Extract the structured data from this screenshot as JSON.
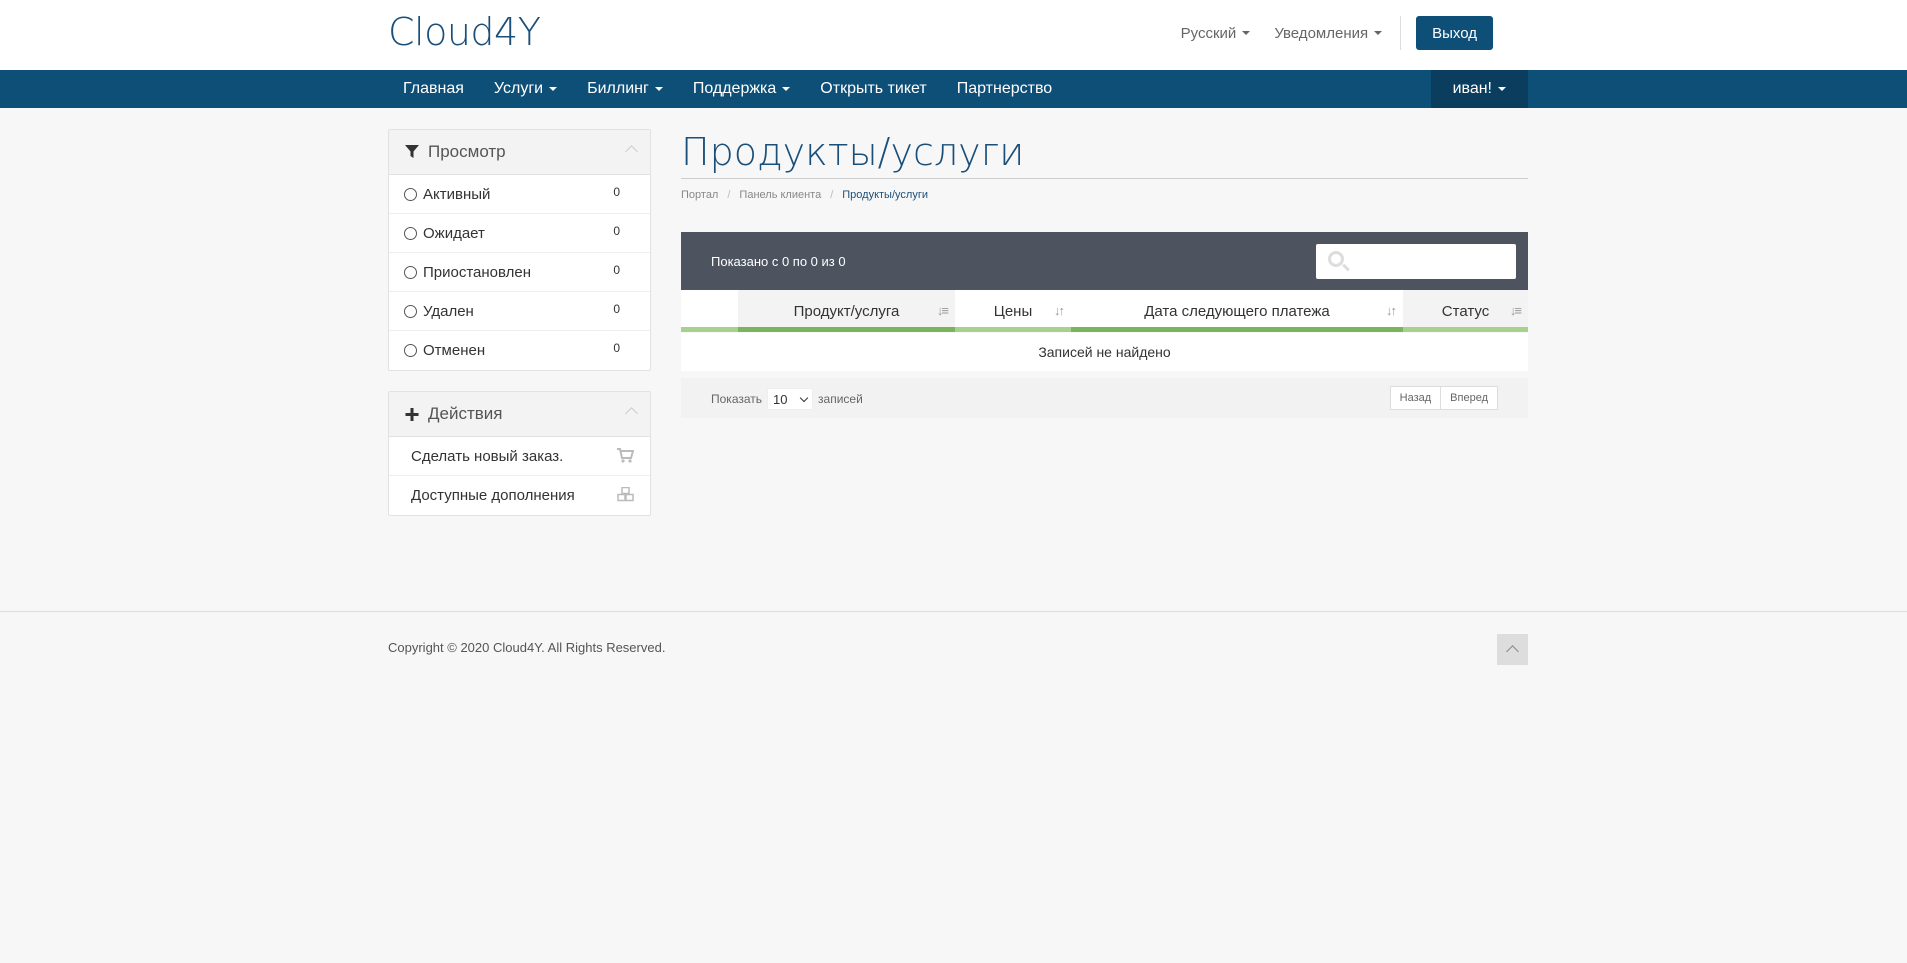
{
  "header": {
    "logo": "Cloud4Y",
    "language": "Русский",
    "notifications": "Уведомления",
    "logout": "Выход"
  },
  "nav": {
    "items": [
      "Главная",
      "Услуги",
      "Биллинг",
      "Поддержка",
      "Открыть тикет",
      "Партнерство"
    ],
    "user": "иван!"
  },
  "sidebar": {
    "view": {
      "title": "Просмотр",
      "filters": [
        {
          "label": "Активный",
          "count": "0"
        },
        {
          "label": "Ожидает",
          "count": "0"
        },
        {
          "label": "Приостановлен",
          "count": "0"
        },
        {
          "label": "Удален",
          "count": "0"
        },
        {
          "label": "Отменен",
          "count": "0"
        }
      ]
    },
    "actions": {
      "title": "Действия",
      "items": [
        {
          "label": "Сделать новый заказ.",
          "icon": "cart-icon"
        },
        {
          "label": "Доступные дополнения",
          "icon": "cubes-icon"
        }
      ]
    }
  },
  "main": {
    "title": "Продукты/услуги",
    "breadcrumb": [
      "Портал",
      "Панель клиента",
      "Продукты/услуги"
    ],
    "table": {
      "info": "Показано с 0 по 0 из 0",
      "search_placeholder": "",
      "columns": [
        "Продукт/услуга",
        "Цены",
        "Дата следующего платежа",
        "Статус"
      ],
      "empty": "Записей не найдено",
      "show_label": "Показать",
      "per_page": "10",
      "records_label": "записей",
      "prev": "Назад",
      "next": "Вперед"
    }
  },
  "footer": {
    "copyright": "Copyright © 2020 Cloud4Y. All Rights Reserved."
  }
}
